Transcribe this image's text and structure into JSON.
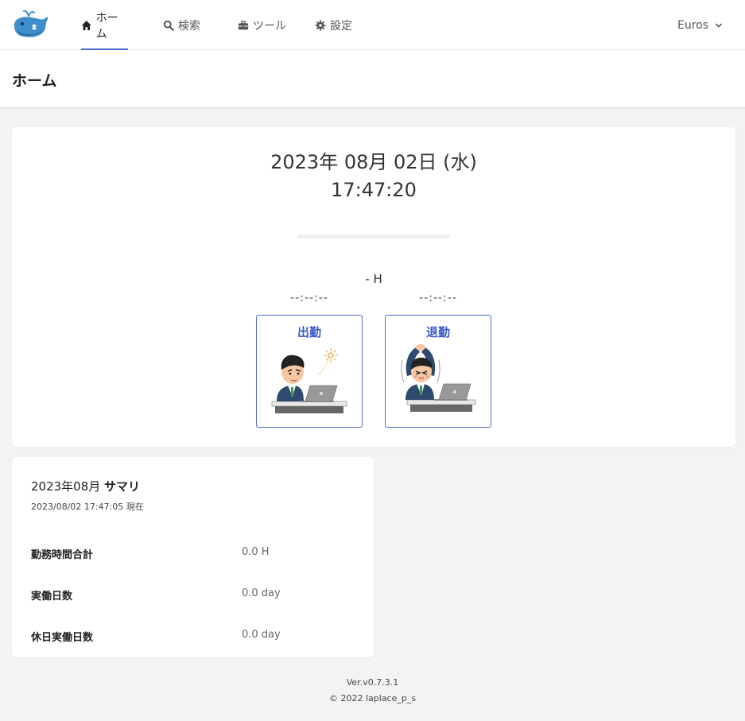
{
  "nav": {
    "items": [
      {
        "label": "ホーム",
        "icon": "home-icon"
      },
      {
        "label": "検索",
        "icon": "search-icon"
      },
      {
        "label": "ツール",
        "icon": "toolbox-icon"
      },
      {
        "label": "設定",
        "icon": "gear-icon"
      }
    ],
    "active_index": 0,
    "user_label": "Euros"
  },
  "page": {
    "title": "ホーム"
  },
  "clock": {
    "date": "2023年 08月 02日 (水)",
    "time": "17:47:20",
    "progress": 0,
    "hours": "- H",
    "clock_in": {
      "time": "--:--:--",
      "label": "出勤"
    },
    "clock_out": {
      "time": "--:--:--",
      "label": "退勤"
    }
  },
  "summary": {
    "title_year_month": "2023年08月",
    "title_suffix": "サマリ",
    "as_of": "2023/08/02 17:47:05 現在",
    "rows": [
      {
        "key": "勤務時間合計",
        "value": "0.0 H"
      },
      {
        "key": "実働日数",
        "value": "0.0 day"
      },
      {
        "key": "休日実働日数",
        "value": "0.0 day"
      }
    ]
  },
  "footer": {
    "version": "Ver.v0.7.3.1",
    "copyright": "© 2022 laplace_p_s"
  },
  "colors": {
    "accent": "#4e6bd6",
    "page_background": "#f2f3f5",
    "card_background": "#ffffff"
  }
}
